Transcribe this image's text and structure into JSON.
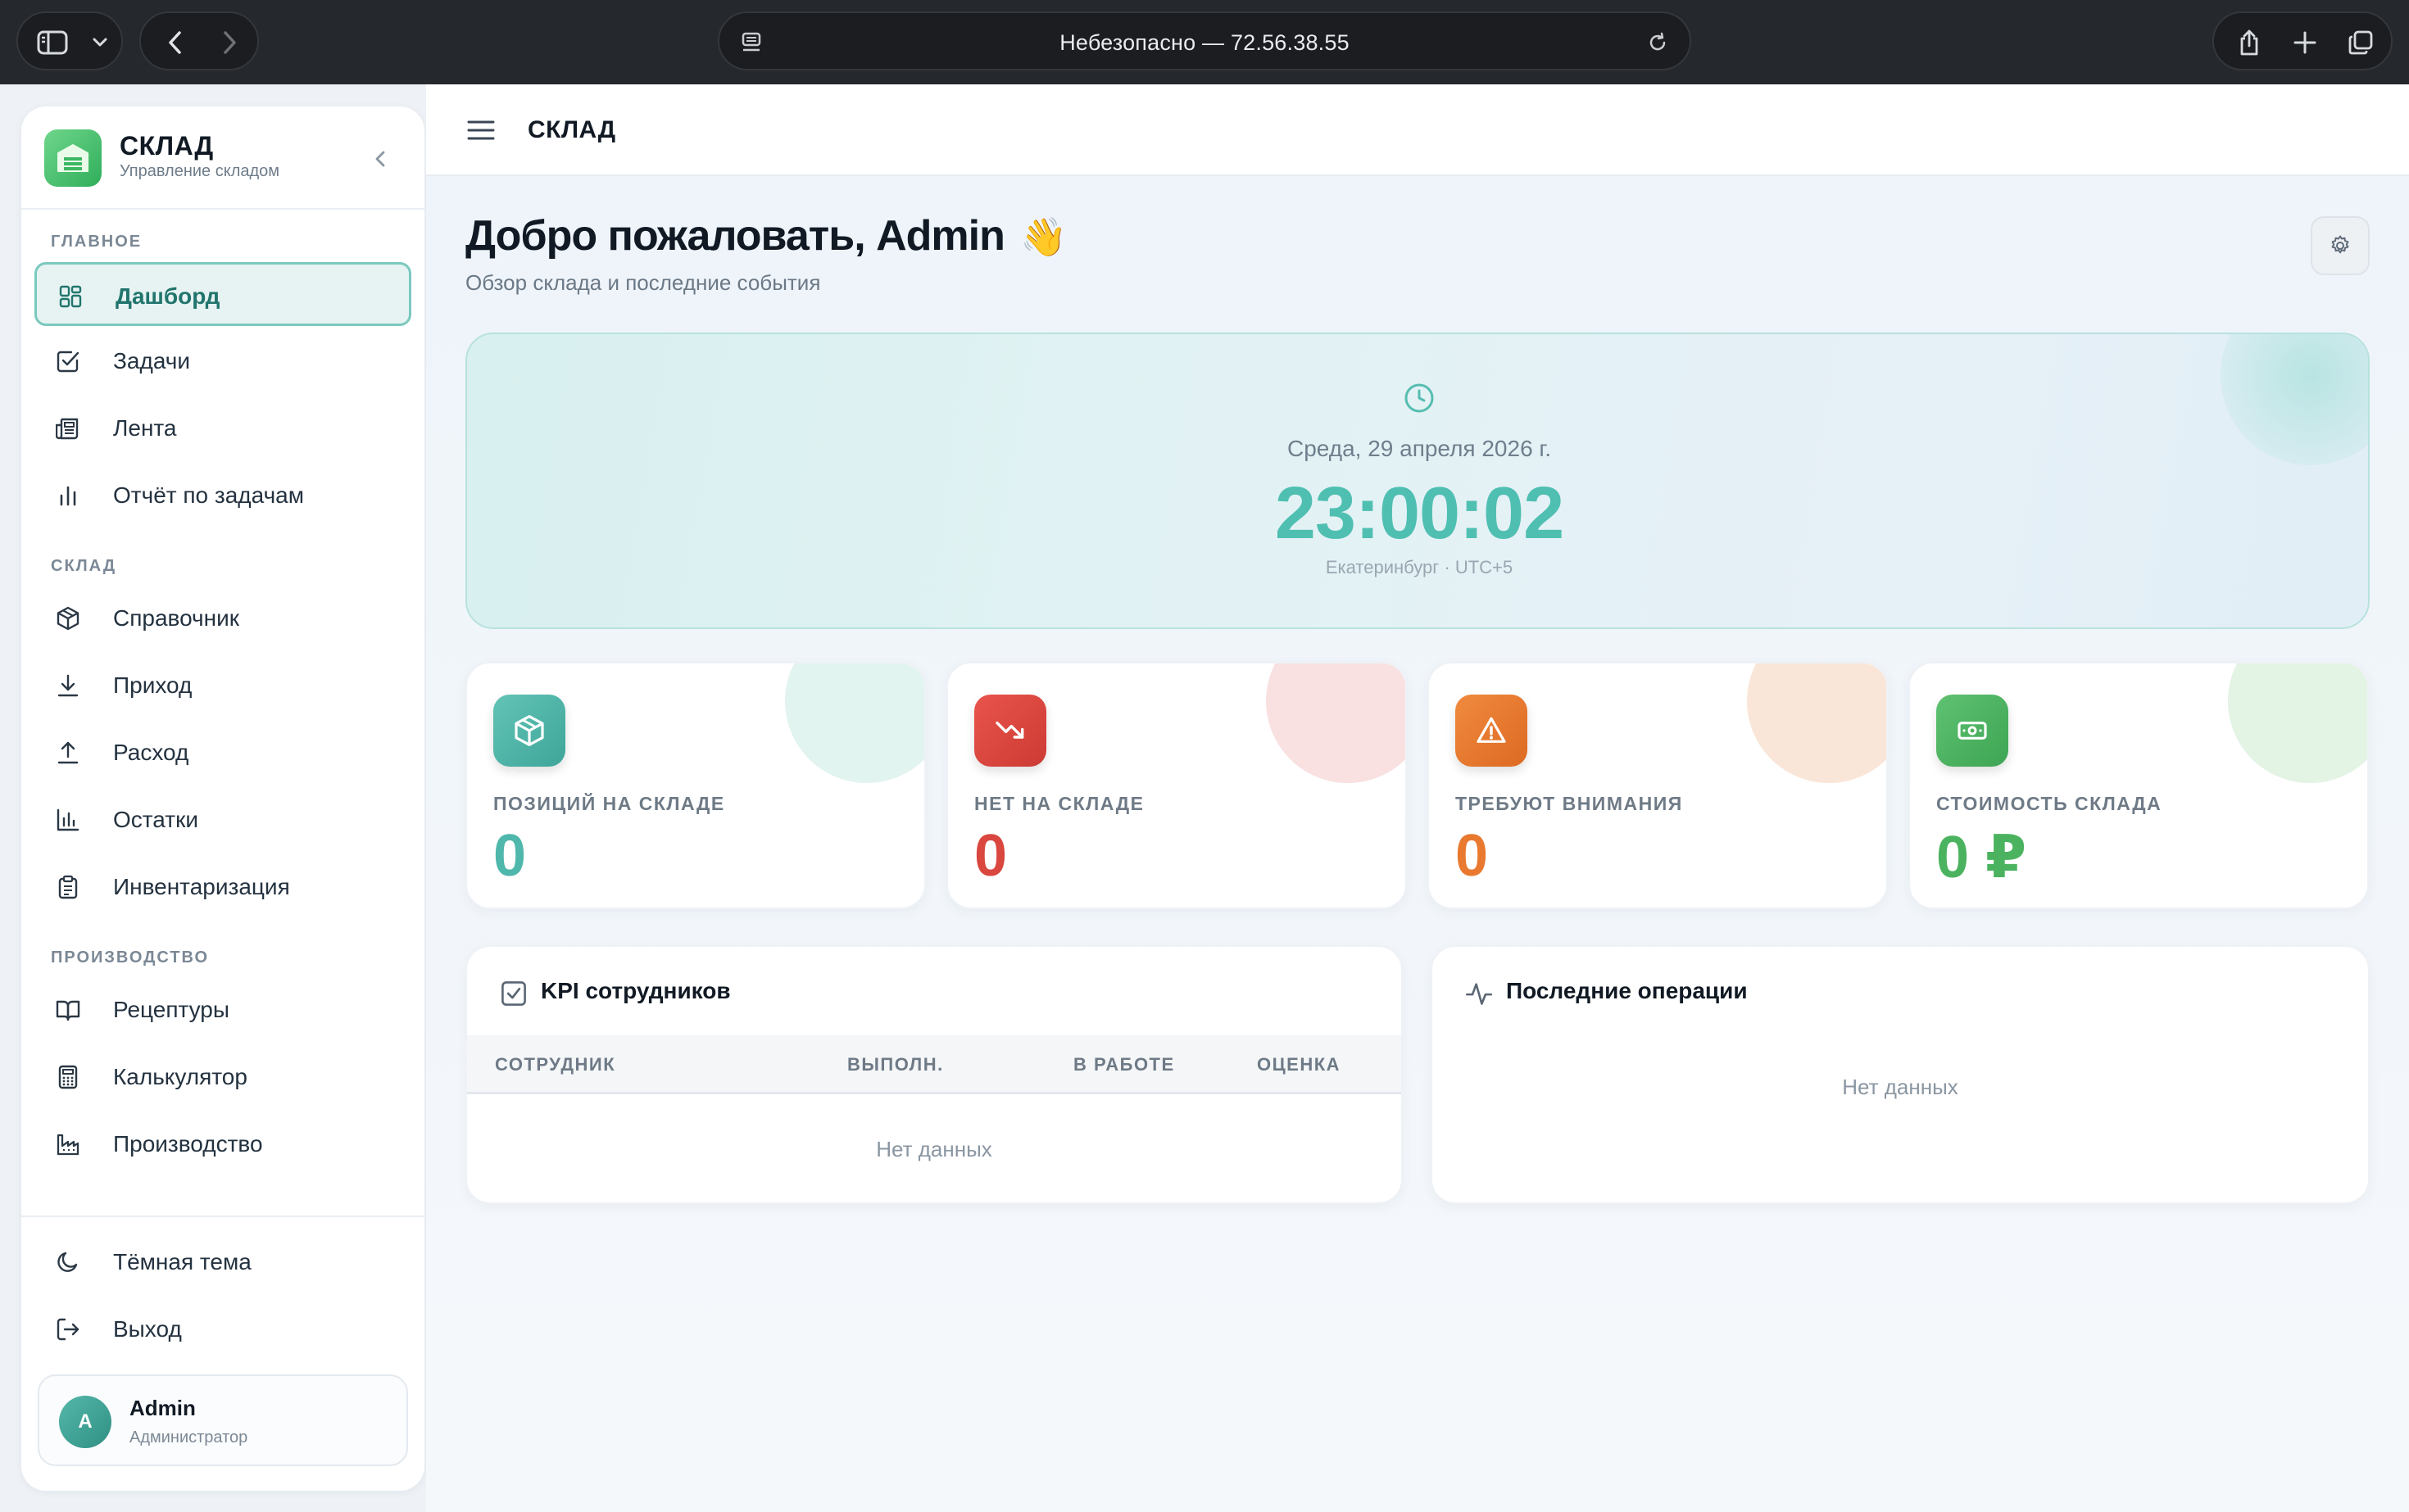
{
  "browser": {
    "url_text": "Небезопасно — 72.56.38.55"
  },
  "sidebar": {
    "brand_name": "СКЛАД",
    "brand_sub": "Управление складом",
    "sections": [
      {
        "title": "ГЛАВНОЕ",
        "items": [
          {
            "label": "Дашборд",
            "icon": "dashboard-icon",
            "active": true
          },
          {
            "label": "Задачи",
            "icon": "checkbox-icon"
          },
          {
            "label": "Лента",
            "icon": "newspaper-icon"
          },
          {
            "label": "Отчёт по задачам",
            "icon": "bar-chart-icon"
          }
        ]
      },
      {
        "title": "СКЛАД",
        "items": [
          {
            "label": "Справочник",
            "icon": "cube-icon"
          },
          {
            "label": "Приход",
            "icon": "arrow-down-icon"
          },
          {
            "label": "Расход",
            "icon": "arrow-up-icon"
          },
          {
            "label": "Остатки",
            "icon": "bar-chart-icon"
          },
          {
            "label": "Инвентаризация",
            "icon": "clipboard-icon"
          }
        ]
      },
      {
        "title": "ПРОИЗВОДСТВО",
        "items": [
          {
            "label": "Рецептуры",
            "icon": "book-icon"
          },
          {
            "label": "Калькулятор",
            "icon": "calculator-icon"
          },
          {
            "label": "Производство",
            "icon": "factory-icon"
          }
        ]
      }
    ],
    "bottom": [
      {
        "label": "Тёмная тема",
        "icon": "moon-icon"
      },
      {
        "label": "Выход",
        "icon": "logout-icon"
      }
    ],
    "user": {
      "initial": "A",
      "name": "Admin",
      "role": "Администратор"
    }
  },
  "topbar": {
    "title": "СКЛАД"
  },
  "page": {
    "title": "Добро пожаловать, Admin",
    "emoji": "👋",
    "subtitle": "Обзор склада и последние события"
  },
  "clock": {
    "date": "Среда, 29 апреля 2026 г.",
    "time": "23:00:02",
    "timezone": "Екатеринбург · UTC+5"
  },
  "stats": [
    {
      "label": "ПОЗИЦИЙ НА СКЛАДЕ",
      "value": "0",
      "icon": "cube-icon",
      "color": "#4fb7ab"
    },
    {
      "label": "НЕТ НА СКЛАДЕ",
      "value": "0",
      "icon": "trending-down-icon",
      "color": "#d9473f"
    },
    {
      "label": "ТРЕБУЮТ ВНИМАНИЯ",
      "value": "0",
      "icon": "warning-icon",
      "color": "#e8792f"
    },
    {
      "label": "СТОИМОСТЬ СКЛАДА",
      "value": "0 ₽",
      "icon": "banknote-icon",
      "color": "#4bb35f"
    }
  ],
  "kpi": {
    "title": "KPI сотрудников",
    "columns": [
      "СОТРУДНИК",
      "ВЫПОЛН.",
      "В РАБОТЕ",
      "ОЦЕНКА"
    ],
    "empty": "Нет данных"
  },
  "operations": {
    "title": "Последние операции",
    "empty": "Нет данных"
  }
}
